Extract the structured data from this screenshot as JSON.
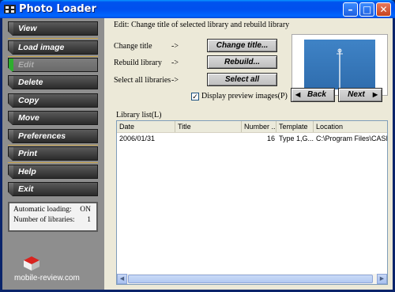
{
  "window": {
    "title": "Photo Loader"
  },
  "sidebar": {
    "items": [
      {
        "label": "View"
      },
      {
        "label": "Load image"
      },
      {
        "label": "Edit"
      },
      {
        "label": "Delete"
      },
      {
        "label": "Copy"
      },
      {
        "label": "Move"
      },
      {
        "label": "Preferences"
      },
      {
        "label": "Print"
      },
      {
        "label": "Help"
      },
      {
        "label": "Exit"
      }
    ],
    "info": {
      "auto_loading_label": "Automatic loading:",
      "auto_loading_value": "ON",
      "num_libraries_label": "Number of libraries:",
      "num_libraries_value": "1"
    },
    "watermark": "mobile-review.com"
  },
  "edit_panel": {
    "heading": "Edit: Change title of selected library and rebuild library",
    "rows": [
      {
        "label": "Change title",
        "arrow": "->",
        "button": "Change title..."
      },
      {
        "label": "Rebuild library",
        "arrow": "->",
        "button": "Rebuild..."
      },
      {
        "label": "Select all libraries",
        "arrow": "->",
        "button": "Select all"
      }
    ],
    "checkbox_label": "Display preview images(P)",
    "checkbox_checked": "✓",
    "back_label": "Back",
    "next_label": "Next"
  },
  "library_list": {
    "label": "Library list(L)",
    "columns": [
      "Date",
      "Title",
      "Number ...",
      "Template",
      "Location"
    ],
    "rows": [
      {
        "date": "2006/01/31",
        "title": "",
        "number": "16",
        "template": "Type 1,G...",
        "location": "C:\\Program Files\\CASIO\\"
      }
    ]
  },
  "colors": {
    "titlebar": "#0053EE",
    "sidebar": "#8E8E8E",
    "nav_button": "#3a3a3a",
    "preview_sky": "#3f83c6"
  },
  "icons": [
    "app-icon",
    "minimize-icon",
    "maximize-icon",
    "close-icon",
    "checkmark-icon",
    "left-triangle-icon",
    "right-triangle-icon",
    "logo-icon"
  ]
}
